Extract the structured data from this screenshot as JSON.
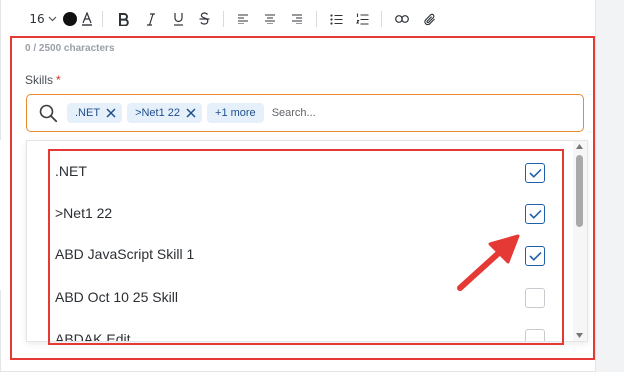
{
  "toolbar": {
    "font_size": "16",
    "items": [
      "text-color",
      "bold",
      "italic",
      "underline",
      "strikethrough",
      "align-left",
      "align-center",
      "align-right",
      "bulleted-list",
      "numbered-list",
      "link",
      "attachment"
    ]
  },
  "editor": {
    "char_count": "0 / 2500 characters"
  },
  "skills": {
    "label": "Skills",
    "required_marker": "*",
    "tags": [
      ".NET",
      ">Net1 22"
    ],
    "more_label": "+1 more",
    "search_placeholder": "Search...",
    "options": [
      {
        "label": ".NET",
        "checked": true
      },
      {
        "label": ">Net1 22",
        "checked": true
      },
      {
        "label": "ABD JavaScript Skill 1",
        "checked": true
      },
      {
        "label": "ABD Oct 10 25 Skill",
        "checked": false
      },
      {
        "label": "ABDAK Edit",
        "checked": false
      }
    ]
  },
  "colors": {
    "accent": "#1f5fa8",
    "focus_border": "#e88a2e",
    "annotation": "#e53935",
    "tag_bg": "#e6f0fb"
  }
}
